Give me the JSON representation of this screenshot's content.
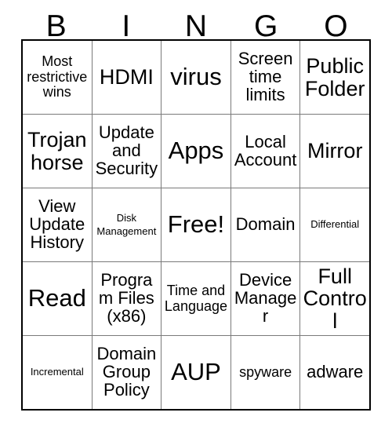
{
  "header": {
    "letters": [
      "B",
      "I",
      "N",
      "G",
      "O"
    ]
  },
  "grid": {
    "columns": 5,
    "rows": 5,
    "cells": [
      [
        {
          "text": "Most restrictive wins",
          "size": "sm"
        },
        {
          "text": "HDMI",
          "size": "lg"
        },
        {
          "text": "virus",
          "size": "xl"
        },
        {
          "text": "Screen time limits",
          "size": "md"
        },
        {
          "text": "Public Folder",
          "size": "lg"
        }
      ],
      [
        {
          "text": "Trojan horse",
          "size": "lg"
        },
        {
          "text": "Update and Security",
          "size": "md"
        },
        {
          "text": "Apps",
          "size": "xl"
        },
        {
          "text": "Local Account",
          "size": "md"
        },
        {
          "text": "Mirror",
          "size": "lg"
        }
      ],
      [
        {
          "text": "View Update History",
          "size": "md"
        },
        {
          "text": "Disk Management",
          "size": "xs"
        },
        {
          "text": "Free!",
          "size": "xl"
        },
        {
          "text": "Domain",
          "size": "md"
        },
        {
          "text": "Differential",
          "size": "xs"
        }
      ],
      [
        {
          "text": "Read",
          "size": "xl"
        },
        {
          "text": "Program Files (x86)",
          "size": "md"
        },
        {
          "text": "Time and Language",
          "size": "sm"
        },
        {
          "text": "Device Manager",
          "size": "md"
        },
        {
          "text": "Full Control",
          "size": "lg"
        }
      ],
      [
        {
          "text": "Incremental",
          "size": "xs"
        },
        {
          "text": "Domain Group Policy",
          "size": "md"
        },
        {
          "text": "AUP",
          "size": "xl"
        },
        {
          "text": "spyware",
          "size": "sm"
        },
        {
          "text": "adware",
          "size": "md"
        }
      ]
    ]
  }
}
